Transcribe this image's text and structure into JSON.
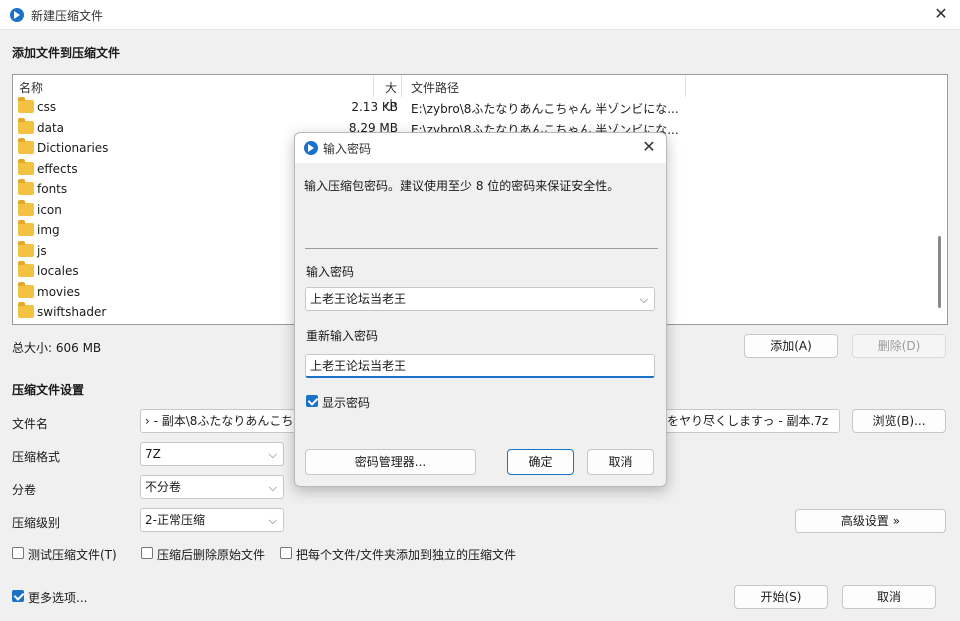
{
  "window": {
    "title": "新建压缩文件"
  },
  "files": {
    "section_title": "添加文件到压缩文件",
    "columns": {
      "name": "名称",
      "size": "大小",
      "path": "文件路径"
    },
    "rows": [
      {
        "name": "css",
        "size": "2.13 KB",
        "path": "E:\\zybro\\8ふたなりあんこちゃん  半ゾンビにな..."
      },
      {
        "name": "data",
        "size": "8.29 MB",
        "path": "E:\\zybro\\8ふたなりあんこちゃん  半ゾンビにな..."
      },
      {
        "name": "Dictionaries",
        "size": "",
        "path": "..."
      },
      {
        "name": "effects",
        "size": "",
        "path": "..."
      },
      {
        "name": "fonts",
        "size": "",
        "path": "..."
      },
      {
        "name": "icon",
        "size": "",
        "path": "..."
      },
      {
        "name": "img",
        "size": "",
        "path": "..."
      },
      {
        "name": "js",
        "size": "",
        "path": "..."
      },
      {
        "name": "locales",
        "size": "",
        "path": "..."
      },
      {
        "name": "movies",
        "size": "",
        "path": "..."
      },
      {
        "name": "swiftshader",
        "size": "",
        "path": "..."
      }
    ],
    "total": "总大小: 606 MB",
    "add_button": "添加(A)",
    "delete_button": "删除(D)"
  },
  "settings": {
    "section_title": "压缩文件设置",
    "filename_label": "文件名",
    "filename_value_left": "› - 副本\\8ふたなりあんこち",
    "filename_value_right": "遣をヤり尽くしますっ - 副本.7z",
    "browse_button": "浏览(B)...",
    "format_label": "压缩格式",
    "format_value": "7Z",
    "volume_label": "分卷",
    "volume_value": "不分卷",
    "level_label": "压缩级别",
    "level_value": "2-正常压缩",
    "advanced_button": "高级设置 »",
    "test_label": "测试压缩文件(T)",
    "delete_source_label": "压缩后删除原始文件",
    "separate_label": "把每个文件/文件夹添加到独立的压缩文件"
  },
  "footer": {
    "more_options": "更多选项...",
    "start_button": "开始(S)",
    "cancel_button": "取消"
  },
  "password_dialog": {
    "title": "输入密码",
    "description": "输入压缩包密码。建议使用至少 8 位的密码来保证安全性。",
    "enter_label": "输入密码",
    "enter_value": "上老王论坛当老王",
    "reenter_label": "重新输入密码",
    "reenter_value": "上老王论坛当老王",
    "show_password_label": "显示密码",
    "manager_button": "密码管理器...",
    "ok_button": "确定",
    "cancel_button": "取消"
  },
  "colors": {
    "accent": "#1a73c9",
    "folder": "#f3c242"
  }
}
